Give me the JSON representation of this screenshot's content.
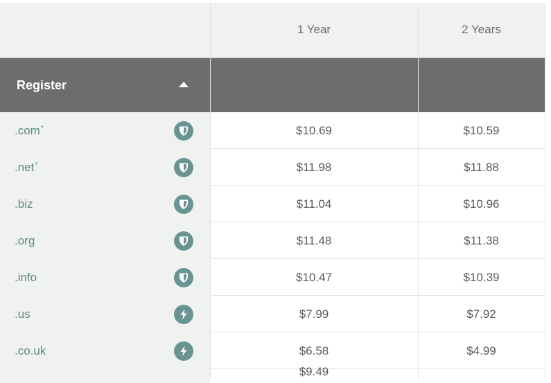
{
  "header": {
    "col1": "1 Year",
    "col2": "2 Years"
  },
  "register": {
    "label": "Register",
    "caret_icon": "caret-up-icon"
  },
  "rows": [
    {
      "tld": ".com",
      "asterisk": "*",
      "icon": "shield-icon",
      "y1": "$10.69",
      "y2": "$10.59"
    },
    {
      "tld": ".net",
      "asterisk": "*",
      "icon": "shield-icon",
      "y1": "$11.98",
      "y2": "$11.88"
    },
    {
      "tld": ".biz",
      "asterisk": "",
      "icon": "shield-icon",
      "y1": "$11.04",
      "y2": "$10.96"
    },
    {
      "tld": ".org",
      "asterisk": "",
      "icon": "shield-icon",
      "y1": "$11.48",
      "y2": "$11.38"
    },
    {
      "tld": ".info",
      "asterisk": "",
      "icon": "shield-icon",
      "y1": "$10.47",
      "y2": "$10.39"
    },
    {
      "tld": ".us",
      "asterisk": "",
      "icon": "lightning-icon",
      "y1": "$7.99",
      "y2": "$7.92"
    },
    {
      "tld": ".co.uk",
      "asterisk": "",
      "icon": "lightning-icon",
      "y1": "$6.58",
      "y2": "$4.99"
    }
  ],
  "partial_row": {
    "y1": "$9.49"
  },
  "colors": {
    "header_bg": "#f0f2f0",
    "register_bar": "#6c6d6f",
    "tld_text": "#5b8a89",
    "badge": "#6a9494"
  }
}
